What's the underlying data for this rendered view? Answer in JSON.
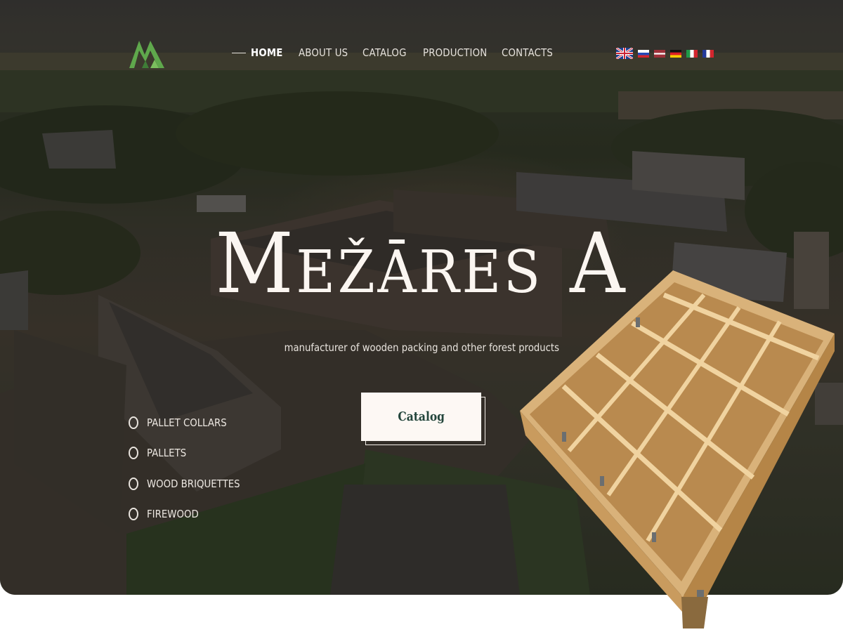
{
  "header": {
    "logo": "mezares-logo",
    "nav": [
      {
        "label": "HOME",
        "active": true
      },
      {
        "label": "ABOUT US",
        "active": false
      },
      {
        "label": "CATALOG",
        "active": false
      },
      {
        "label": "PRODUCTION",
        "active": false
      },
      {
        "label": "CONTACTS",
        "active": false
      }
    ],
    "languages": [
      "uk-flag",
      "ru-flag",
      "lv-flag",
      "de-flag",
      "it-flag",
      "fr-flag"
    ]
  },
  "hero": {
    "title": "Mežāres A",
    "subtitle": "manufacturer of wooden packing and other forest products",
    "cta_label": "Catalog"
  },
  "categories": [
    {
      "label": "PALLET COLLARS"
    },
    {
      "label": "PALLETS"
    },
    {
      "label": "WOOD BRIQUETTES"
    },
    {
      "label": "FIREWOOD"
    }
  ],
  "colors": {
    "logo_green": "#5fa84c",
    "logo_dark_green": "#3f7d37",
    "button_text": "#23453b",
    "button_bg": "#fdf8f4",
    "hero_text": "#fbf6f1"
  }
}
